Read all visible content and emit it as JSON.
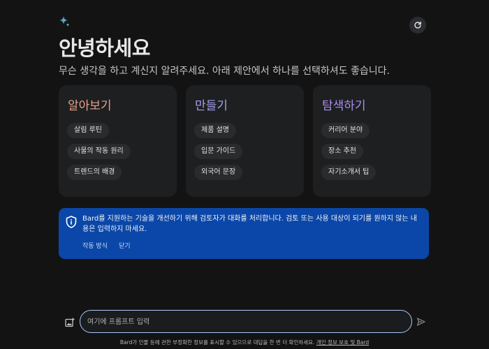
{
  "header": {
    "title": "안녕하세요",
    "subtitle": "무슨 생각을 하고 계신지 알려주세요. 아래 제안에서 하나를 선택하셔도 좋습니다.",
    "logo_icon": "sparkle-icon",
    "refresh_icon": "refresh-icon"
  },
  "cards": [
    {
      "title": "알아보기",
      "title_color": "#e8a08c",
      "chips": [
        "살림 루틴",
        "사물의 작동 원리",
        "트렌드의 배경"
      ]
    },
    {
      "title": "만들기",
      "title_color": "#a5a0f2",
      "chips": [
        "제품 설명",
        "입문 가이드",
        "외국어 문장"
      ]
    },
    {
      "title": "탐색하기",
      "title_color": "#a98ef0",
      "chips": [
        "커리어 분야",
        "장소 추천",
        "자기소개서 팁"
      ]
    }
  ],
  "notice": {
    "icon": "shield-icon",
    "text": "Bard를 지원하는 기술을 개선하기 위해 검토자가 대화를 처리합니다. 검토 또는 사용 대상이 되기를 원하지 않는 내용은 입력하지 마세요.",
    "link_how": "작동 방식",
    "link_close": "닫기",
    "bg_color": "#0b47a8"
  },
  "prompt": {
    "placeholder": "여기에 프롬프트 입력",
    "image_icon": "add-image-icon",
    "send_icon": "send-icon"
  },
  "footer": {
    "text": "Bard가 인물 등에 관한 부정확한 정보를 표시할 수 있으므로 대답을 한 번 더 확인하세요.",
    "link": "개인 정보 보호 및 Bard"
  }
}
